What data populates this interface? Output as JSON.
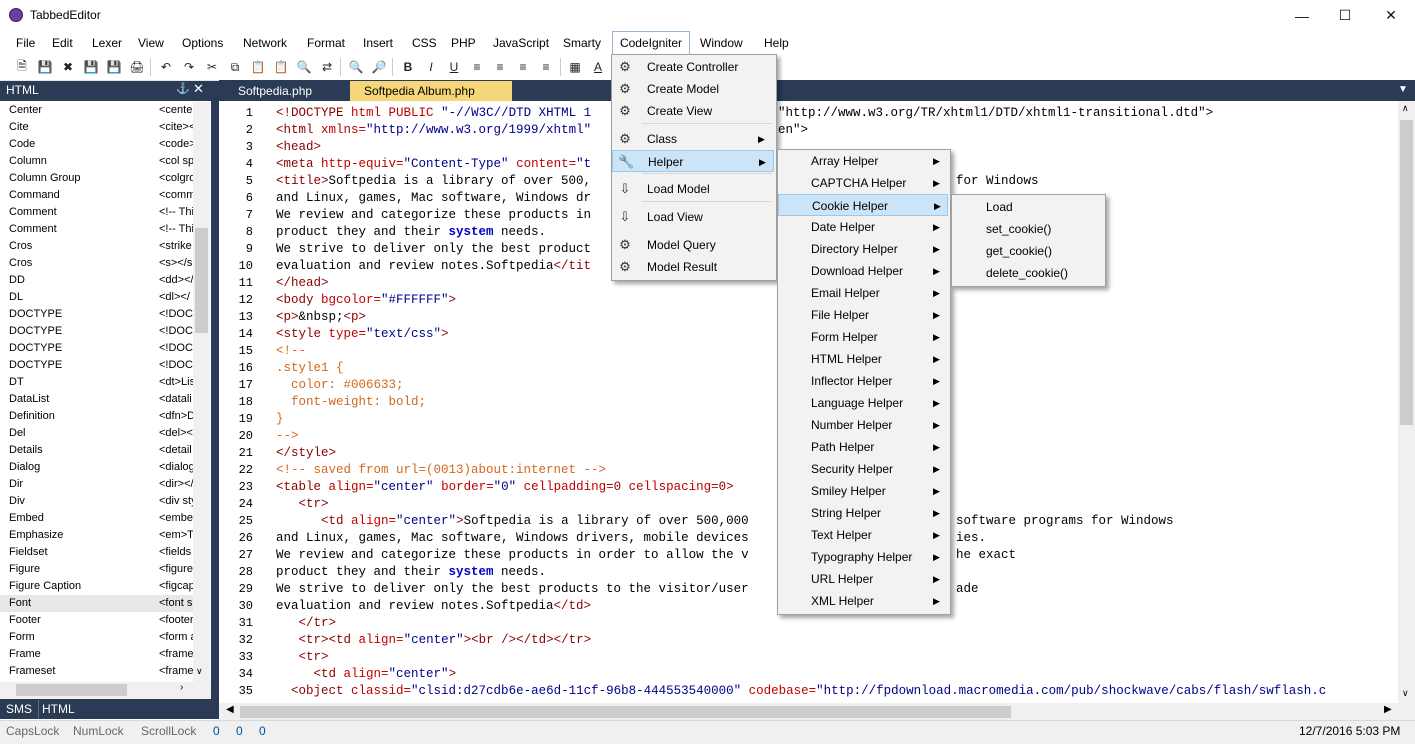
{
  "window": {
    "title": "TabbedEditor",
    "minimize_icon": "minimize-icon",
    "maximize_icon": "maximize-icon",
    "close_icon": "close-icon"
  },
  "menubar": [
    "File",
    "Edit",
    "Lexer",
    "View",
    "Options",
    "Network",
    "Format",
    "Insert",
    "CSS",
    "PHP",
    "JavaScript",
    "Smarty",
    "CodeIgniter",
    "Window",
    "Help"
  ],
  "left_panel": {
    "title": "HTML",
    "pin_icon": "pin-icon",
    "items": [
      {
        "name": "Center",
        "code": "<cente"
      },
      {
        "name": "Cite",
        "code": "<cite><"
      },
      {
        "name": "Code",
        "code": "<code>"
      },
      {
        "name": "Column",
        "code": "<col sp"
      },
      {
        "name": "Column Group",
        "code": "<colgro"
      },
      {
        "name": "Command",
        "code": "<comm"
      },
      {
        "name": "Comment",
        "code": "<!-- Thi"
      },
      {
        "name": "Comment",
        "code": "<!-- Thi"
      },
      {
        "name": "Cros",
        "code": "<strike"
      },
      {
        "name": "Cros",
        "code": "<s></s"
      },
      {
        "name": "DD",
        "code": "<dd></"
      },
      {
        "name": "DL",
        "code": "<dl></"
      },
      {
        "name": "DOCTYPE",
        "code": "<!DOC"
      },
      {
        "name": "DOCTYPE",
        "code": "<!DOC"
      },
      {
        "name": "DOCTYPE",
        "code": "<!DOC"
      },
      {
        "name": "DOCTYPE",
        "code": "<!DOC"
      },
      {
        "name": "DT",
        "code": "<dt>Lis"
      },
      {
        "name": "DataList",
        "code": "<datali"
      },
      {
        "name": "Definition",
        "code": "<dfn>D"
      },
      {
        "name": "Del",
        "code": "<del><"
      },
      {
        "name": "Details",
        "code": "<detail"
      },
      {
        "name": "Dialog",
        "code": "<dialog"
      },
      {
        "name": "Dir",
        "code": "<dir></"
      },
      {
        "name": "Div",
        "code": "<div sty"
      },
      {
        "name": "Embed",
        "code": "<embe"
      },
      {
        "name": "Emphasize",
        "code": "<em>T"
      },
      {
        "name": "Fieldset",
        "code": "<fields"
      },
      {
        "name": "Figure",
        "code": "<figure"
      },
      {
        "name": "Figure Caption",
        "code": "<figcap"
      },
      {
        "name": "Font",
        "code": "<font s"
      },
      {
        "name": "Footer",
        "code": "<footer"
      },
      {
        "name": "Form",
        "code": "<form a"
      },
      {
        "name": "Frame",
        "code": "<frame"
      },
      {
        "name": "Frameset",
        "code": "<frame"
      }
    ],
    "selected_index": 29,
    "bottom_tabs": [
      "SMS",
      "HTML"
    ]
  },
  "tabs": [
    "Softpedia.php",
    "Softpedia Album.php"
  ],
  "active_tab_index": 1,
  "editor": {
    "line_numbers": [
      "1",
      "2",
      "3",
      "4",
      "5",
      "6",
      "7",
      "8",
      "9",
      "10",
      "11",
      "12",
      "13",
      "14",
      "15",
      "16",
      "17",
      "18",
      "19",
      "20",
      "21",
      "22",
      "23",
      "24",
      "25",
      "26",
      "27",
      "28",
      "29",
      "30",
      "31",
      "32",
      "33",
      "34",
      "35"
    ],
    "lines": [
      "<!DOCTYPE html PUBLIC \"-//W3C//DTD XHTML 1",
      "<html xmlns=\"http://www.w3.org/1999/xhtml\"",
      "<head>",
      "<meta http-equiv=\"Content-Type\" content=\"t",
      "<title>Softpedia is a library of over 500,",
      "and Linux, games, Mac software, Windows dr",
      "We review and categorize these products in",
      "product they and their system needs.",
      "We strive to deliver only the best product",
      "evaluation and review notes.Softpedia</tit",
      "</head>",
      "<body bgcolor=\"#FFFFFF\">",
      "<p>&nbsp;<p>",
      "<style type=\"text/css\">",
      "<!--",
      ".style1 {",
      "  color: #006633;",
      "  font-weight: bold;",
      "}",
      "-->",
      "</style>",
      "<!-- saved from url=(0013)about:internet -->",
      "<table align=\"center\" border=\"0\" cellpadding=0 cellspacing=0>",
      "   <tr>",
      "      <td align=\"center\">Softpedia is a library of over 500,000",
      "and Linux, games, Mac software, Windows drivers, mobile devices",
      "We review and categorize these products in order to allow the v",
      "product they and their system needs.",
      "We strive to deliver only the best products to the visitor/user",
      "evaluation and review notes.Softpedia</td>",
      "   </tr>",
      "   <tr><td align=\"center\"><br /></td></tr>",
      "   <tr>",
      "     <td align=\"center\">",
      "  <object classid=\"clsid:d27cdb6e-ae6d-11cf-96b8-444553540000\" codebase=\"http://fpdownload.macromedia.com/pub/shockwave/cabs/flash/swflash.c"
    ],
    "right_fragments": [
      {
        "line": 1,
        "text": "\"http://www.w3.org/TR/xhtml1/DTD/xhtml1-transitional.dtd\">"
      },
      {
        "line": 2,
        "text": "en\">"
      },
      {
        "line": 5,
        "text": "for Windows"
      },
      {
        "line": 25,
        "text": "software programs for Windows"
      },
      {
        "line": 26,
        "text": "ies."
      },
      {
        "line": 27,
        "text": "he exact"
      },
      {
        "line": 29,
        "text": "ade"
      }
    ]
  },
  "codeigniter_menu": {
    "items": [
      {
        "label": "Create Controller",
        "icon": "controller-icon",
        "submenu": false
      },
      {
        "label": "Create Model",
        "icon": "model-icon",
        "submenu": false
      },
      {
        "label": "Create View",
        "icon": "view-icon",
        "submenu": false
      },
      {
        "label": "Class",
        "icon": "class-icon",
        "submenu": true
      },
      {
        "label": "Helper",
        "icon": "helper-icon",
        "submenu": true
      },
      {
        "label": "Load Model",
        "icon": "load-model-icon",
        "submenu": false
      },
      {
        "label": "Load View",
        "icon": "load-view-icon",
        "submenu": false
      },
      {
        "label": "Model Query",
        "icon": "model-query-icon",
        "submenu": false
      },
      {
        "label": "Model Result",
        "icon": "model-result-icon",
        "submenu": false
      }
    ]
  },
  "helper_menu": {
    "items": [
      "Array Helper",
      "CAPTCHA Helper",
      "Cookie Helper",
      "Date Helper",
      "Directory Helper",
      "Download Helper",
      "Email Helper",
      "File Helper",
      "Form Helper",
      "HTML Helper",
      "Inflector Helper",
      "Language Helper",
      "Number Helper",
      "Path Helper",
      "Security Helper",
      "Smiley Helper",
      "String Helper",
      "Text Helper",
      "Typography Helper",
      "URL Helper",
      "XML Helper"
    ],
    "highlighted_index": 2
  },
  "cookie_menu": {
    "items": [
      "Load",
      "set_cookie()",
      "get_cookie()",
      "delete_cookie()"
    ]
  },
  "statusbar": {
    "caps": "CapsLock",
    "num": "NumLock",
    "scroll": "ScrollLock",
    "v1": "0",
    "v2": "0",
    "v3": "0",
    "datetime": "12/7/2016 5:03 PM"
  },
  "colors": {
    "accent_dark": "#2b3b56",
    "active_tab": "#f5d77a",
    "menu_highlight": "#cce4f7"
  }
}
